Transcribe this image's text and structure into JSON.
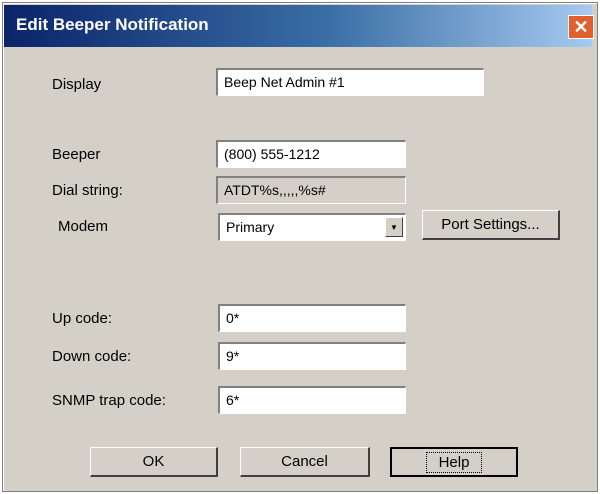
{
  "window": {
    "title": "Edit Beeper Notification",
    "close_label": "✕"
  },
  "labels": {
    "display": "Display",
    "beeper": "Beeper",
    "dial_string": "Dial string:",
    "modem": "Modem",
    "up_code": "Up code:",
    "down_code": "Down code:",
    "snmp_trap_code": "SNMP trap code:"
  },
  "fields": {
    "display": "Beep Net Admin #1",
    "beeper": "(800) 555-1212",
    "dial_string": "ATDT%s,,,,,%s#",
    "modem_selected": "Primary",
    "up_code": "0*",
    "down_code": "9*",
    "snmp_trap_code": "6*"
  },
  "buttons": {
    "port_settings": "Port Settings...",
    "ok": "OK",
    "cancel": "Cancel",
    "help": "Help"
  }
}
